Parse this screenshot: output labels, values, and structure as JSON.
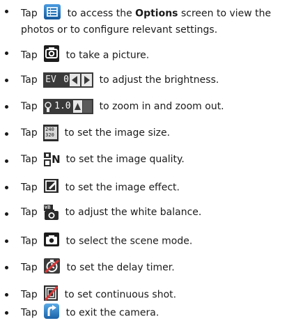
{
  "items": [
    {
      "icon": "options-icon",
      "pre": "Tap",
      "text": "to access the ",
      "bold": "Options",
      "after": " screen to view the",
      "cont": "photos or to configure relevant settings."
    },
    {
      "icon": "camera-shutter-icon",
      "pre": "Tap",
      "text": "to take a picture."
    },
    {
      "icon": "exposure-value-icon",
      "pre": "Tap",
      "text": "to adjust the brightness.",
      "ev_label": "EV",
      "ev_value": "0"
    },
    {
      "icon": "zoom-icon",
      "pre": "Tap",
      "text": "to zoom in and zoom out.",
      "zoom_value": "1.0"
    },
    {
      "icon": "image-size-icon",
      "pre": "Tap",
      "text": "to set the image size.",
      "size_top": "240",
      "size_bottom": "320"
    },
    {
      "icon": "image-quality-icon",
      "pre": "Tap",
      "text": "to set the image quality.",
      "quality_label": "N"
    },
    {
      "icon": "image-effect-icon",
      "pre": "Tap",
      "text": "to set the image effect."
    },
    {
      "icon": "white-balance-icon",
      "pre": "Tap",
      "text": "to adjust the white balance.",
      "wb_label": "WB"
    },
    {
      "icon": "scene-mode-icon",
      "pre": "Tap",
      "text": "to select the scene mode."
    },
    {
      "icon": "delay-timer-icon",
      "pre": "Tap",
      "text": "to set the delay timer."
    },
    {
      "icon": "continuous-shot-icon",
      "pre": "Tap",
      "text": "to set continuous shot."
    },
    {
      "icon": "exit-camera-icon",
      "pre": "Tap",
      "text": "to exit the camera."
    }
  ],
  "colors": {
    "icon_dark": "#1c1c1c",
    "icon_mid": "#5a5a5a",
    "icon_blue": "#1f6fb5",
    "text": "#1a1a1a"
  }
}
